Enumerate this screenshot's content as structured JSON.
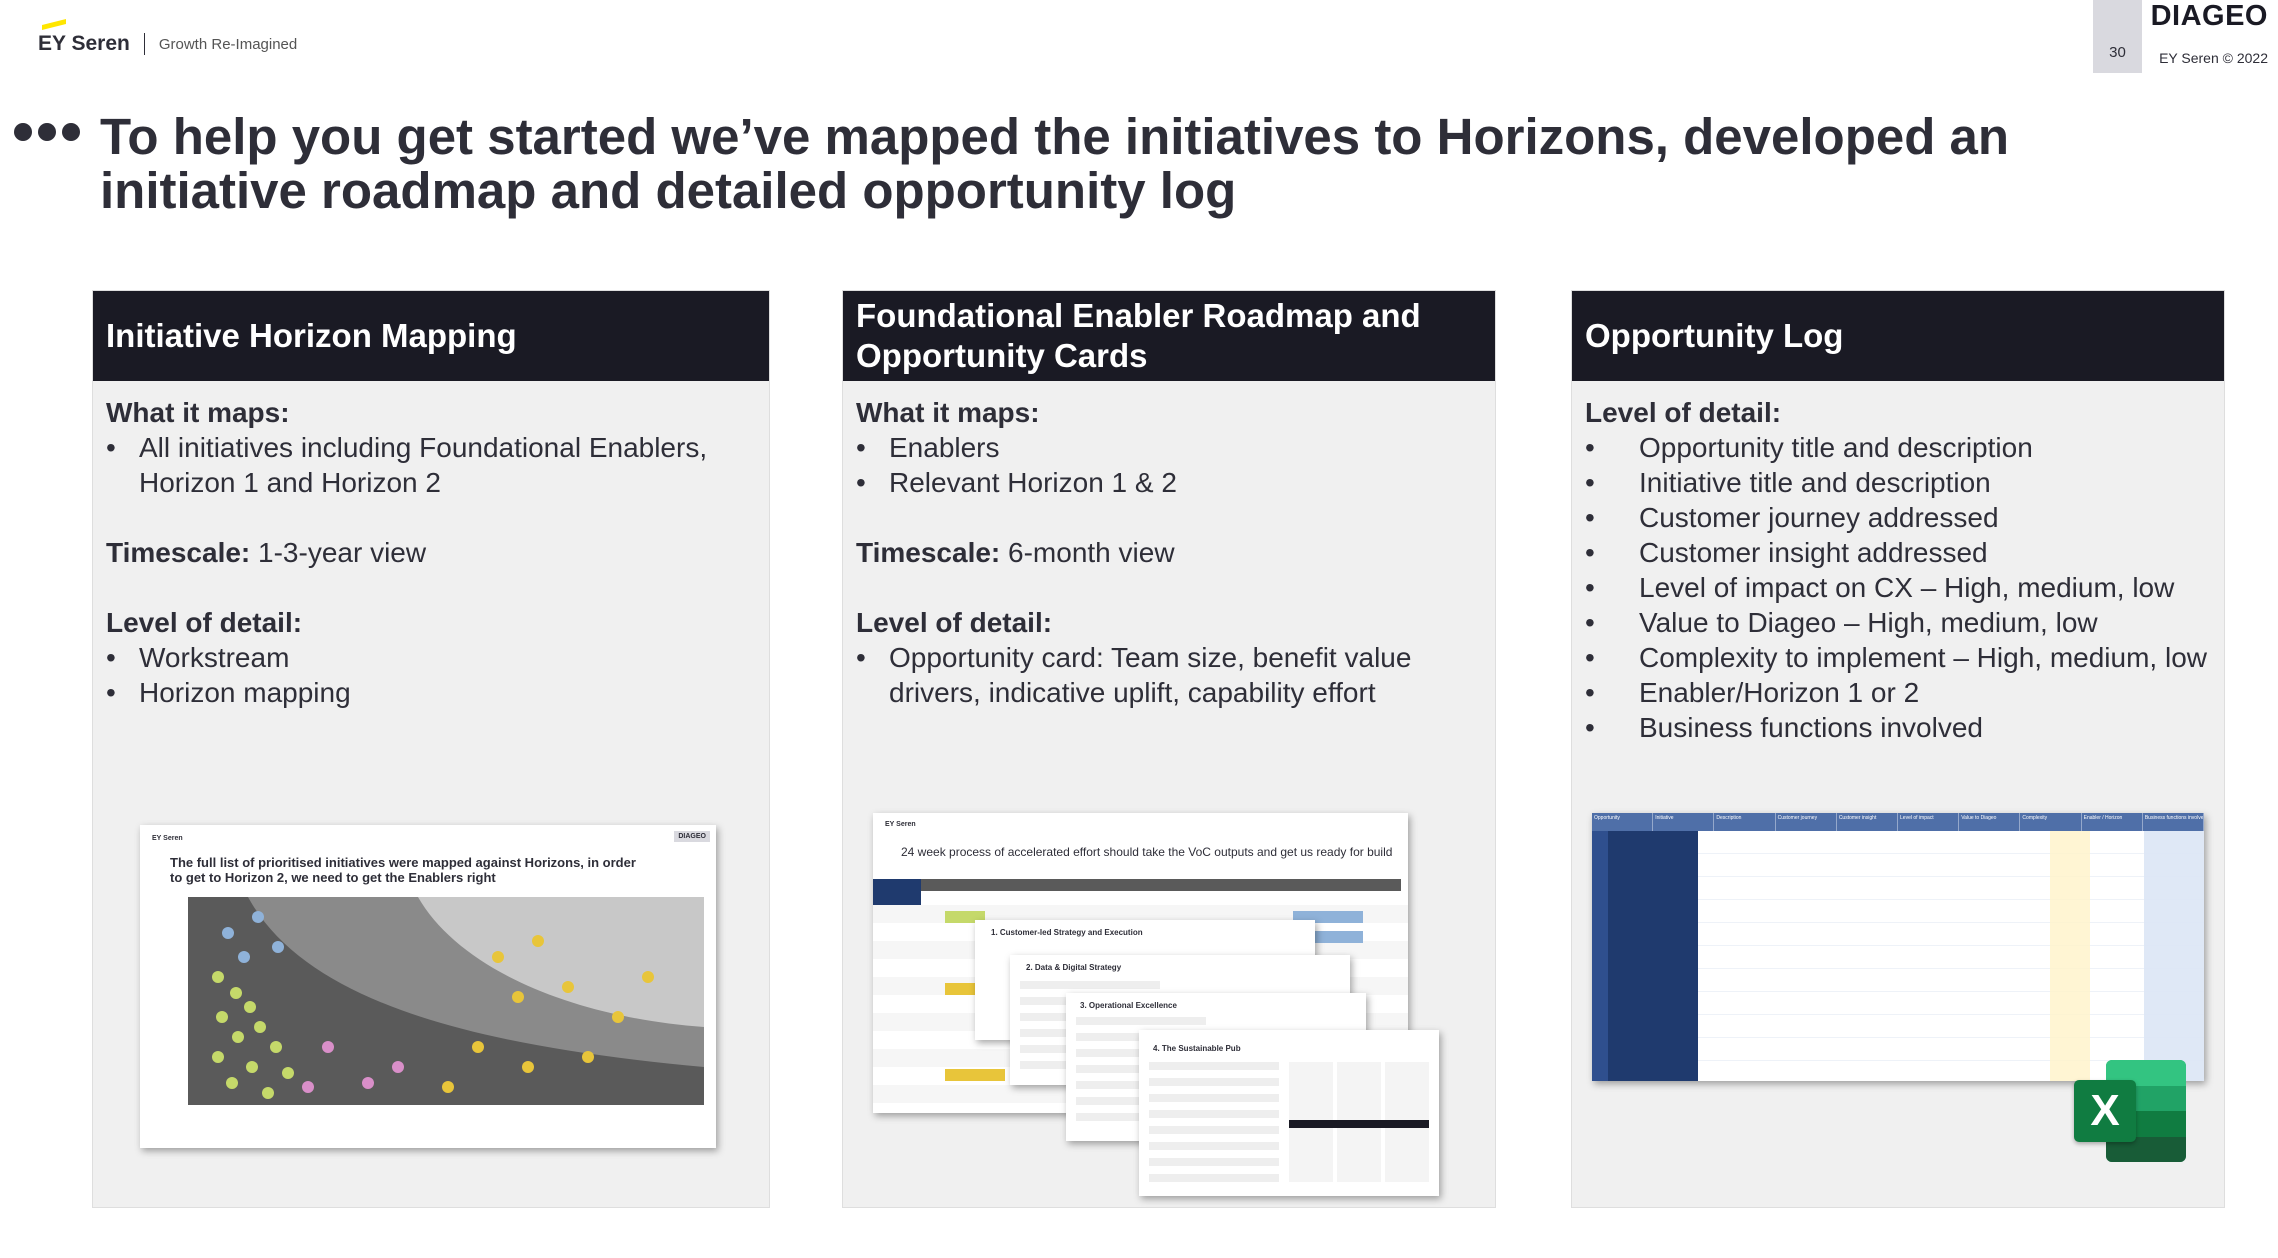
{
  "header": {
    "brand_logo": "EY Seren",
    "tagline": "Growth Re-Imagined",
    "page_number": "30",
    "client_logo": "DIAGEO",
    "copyright": "EY Seren © 2022"
  },
  "title": "To help you get started we’ve mapped the initiatives to Horizons, developed an initiative roadmap and detailed opportunity log",
  "panels": [
    {
      "heading": "Initiative Horizon Mapping",
      "sections": [
        {
          "label": "What it maps:",
          "items": [
            "All initiatives including Foundational Enablers, Horizon 1 and Horizon 2"
          ]
        },
        {
          "label": "Timescale:",
          "value": "1-3-year view"
        },
        {
          "label": "Level of detail:",
          "items": [
            "Workstream",
            "Horizon mapping"
          ]
        }
      ],
      "thumbnail": {
        "title": "The full list of prioritised initiatives were mapped against Horizons, in order to get to Horizon 2, we need to get the Enablers right",
        "logo": "DIAGEO"
      }
    },
    {
      "heading": "Foundational Enabler Roadmap and Opportunity Cards",
      "sections": [
        {
          "label": "What it maps:",
          "items": [
            "Enablers",
            "Relevant Horizon 1 & 2"
          ]
        },
        {
          "label": "Timescale:",
          "value": "6-month view"
        },
        {
          "label": "Level of detail:",
          "items": [
            "Opportunity card: Team size, benefit value drivers, indicative uplift, capability effort"
          ]
        }
      ],
      "thumbnail": {
        "title": "24 week process of accelerated effort should take the VoC outputs and get us ready for build",
        "cards": [
          "1. Customer-led Strategy and Execution",
          "2. Data & Digital Strategy",
          "3. Operational Excellence",
          "4. The Sustainable Pub"
        ]
      }
    },
    {
      "heading": "Opportunity Log",
      "sections": [
        {
          "label": "Level of detail:",
          "items": [
            "Opportunity title and description",
            "Initiative title and description",
            "Customer journey addressed",
            "Customer insight addressed",
            "Level of impact on CX – High, medium, low",
            "Value to Diageo – High, medium, low",
            "Complexity to implement – High, medium, low",
            "Enabler/Horizon 1 or 2",
            "Business functions involved"
          ]
        }
      ],
      "thumbnail": {
        "columns": [
          "Opportunity",
          "Initiative",
          "Description",
          "Customer journey",
          "Customer insight",
          "Level of impact",
          "Value to Diageo",
          "Complexity",
          "Enabler / Horizon",
          "Business functions involved"
        ]
      }
    }
  ],
  "icons": {
    "excel": "excel-icon"
  },
  "colors": {
    "header_dark": "#1a1a24",
    "panel_bg": "#f0f0f0",
    "accent_yellow": "#ffe600",
    "excel_green": "#107c41",
    "log_blue": "#1f3a6e"
  }
}
